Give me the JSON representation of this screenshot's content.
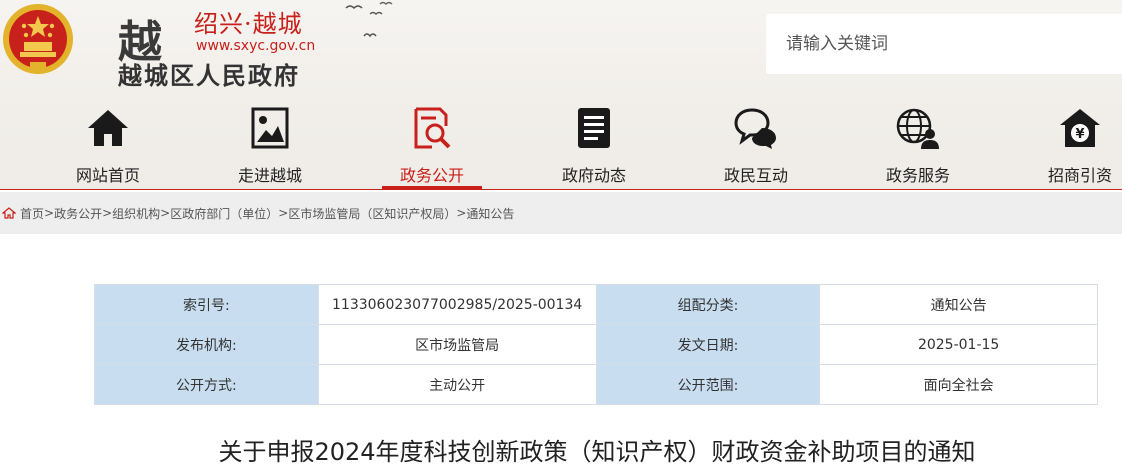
{
  "brand": {
    "logo_char": "越",
    "city": "绍兴·越城",
    "url": "www.sxyc.gov.cn",
    "name": "越城区人民政府",
    "emblem_icon": "national-emblem-icon"
  },
  "search": {
    "placeholder": "请输入关键词"
  },
  "nav": {
    "items": [
      {
        "label": "网站首页",
        "icon": "home-icon"
      },
      {
        "label": "走进越城",
        "icon": "picture-icon"
      },
      {
        "label": "政务公开",
        "icon": "document-search-icon",
        "active": true
      },
      {
        "label": "政府动态",
        "icon": "news-icon"
      },
      {
        "label": "政民互动",
        "icon": "chat-icon"
      },
      {
        "label": "政务服务",
        "icon": "globe-user-icon"
      },
      {
        "label": "招商引资",
        "icon": "money-house-icon"
      }
    ]
  },
  "colors": {
    "accent": "#c8201a",
    "table_key_bg": "#c8ddef",
    "crumb_bg": "#eeeeee"
  },
  "breadcrumb": {
    "items": [
      "首页",
      "政务公开",
      "组织机构",
      "区政府部门（单位）",
      "区市场监管局（区知识产权局）",
      "通知公告"
    ],
    "separator": ">"
  },
  "meta": {
    "rows": [
      {
        "k1": "索引号:",
        "v1": "113306023077002985/2025-00134",
        "k2": "组配分类:",
        "v2": "通知公告"
      },
      {
        "k1": "发布机构:",
        "v1": "区市场监管局",
        "k2": "发文日期:",
        "v2": "2025-01-15"
      },
      {
        "k1": "公开方式:",
        "v1": "主动公开",
        "k2": "公开范围:",
        "v2": "面向全社会"
      }
    ]
  },
  "article": {
    "title": "关于申报2024年度科技创新政策（知识产权）财政资金补助项目的通知"
  }
}
